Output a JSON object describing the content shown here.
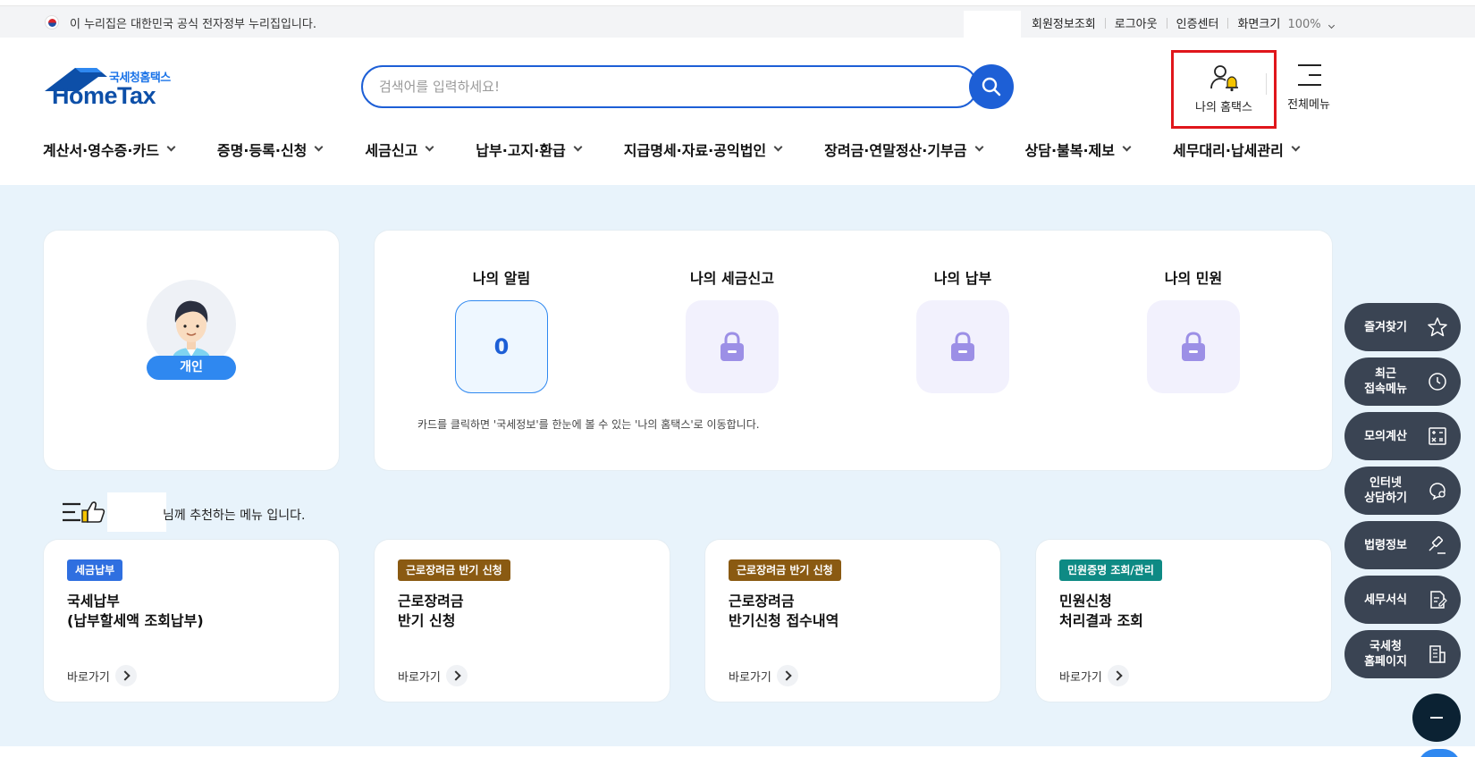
{
  "gov_banner": {
    "text": "이 누리집은 대한민국 공식 전자정부 누리집입니다."
  },
  "util": {
    "member_info": "회원정보조회",
    "logout": "로그아웃",
    "cert_center": "인증센터",
    "screen_size": "화면크기",
    "zoom": "100%"
  },
  "logo": {
    "small": "국세청홈택스",
    "big": "HomeTax"
  },
  "search": {
    "placeholder": "검색어를 입력하세요!"
  },
  "header": {
    "my_hometax": "나의 홈택스",
    "all_menu": "전체메뉴"
  },
  "gnb": [
    {
      "label": "계산서·영수증·카드"
    },
    {
      "label": "증명·등록·신청"
    },
    {
      "label": "세금신고"
    },
    {
      "label": "납부·고지·환급"
    },
    {
      "label": "지급명세·자료·공익법인"
    },
    {
      "label": "장려금·연말정산·기부금"
    },
    {
      "label": "상담·불복·제보"
    },
    {
      "label": "세무대리·납세관리"
    }
  ],
  "profile": {
    "type": "개인"
  },
  "summary": {
    "items": [
      {
        "title": "나의 알림",
        "value": "0"
      },
      {
        "title": "나의 세금신고"
      },
      {
        "title": "나의 납부"
      },
      {
        "title": "나의 민원"
      }
    ],
    "note": "카드를 클릭하면 '국세정보'를 한눈에 볼 수 있는 '나의 홈택스'로 이동합니다."
  },
  "recommend": {
    "text": "님께 추천하는 메뉴 입니다.",
    "cards": [
      {
        "tag": "세금납부",
        "tag_color": "#2f6fe0",
        "line1": "국세납부",
        "line2": "(납부할세액 조회납부)",
        "go": "바로가기"
      },
      {
        "tag": "근로장려금 반기 신청",
        "tag_color": "#8a5a12",
        "line1": "근로장려금",
        "line2": "반기 신청",
        "go": "바로가기"
      },
      {
        "tag": "근로장려금 반기 신청",
        "tag_color": "#8a5a12",
        "line1": "근로장려금",
        "line2": "반기신청 접수내역",
        "go": "바로가기"
      },
      {
        "tag": "민원증명 조회/관리",
        "tag_color": "#0e8a84",
        "line1": "민원신청",
        "line2": "처리결과 조회",
        "go": "바로가기"
      }
    ]
  },
  "quick_menu": [
    {
      "label": "즐겨찾기",
      "icon": "star-icon"
    },
    {
      "label": "최근\n접속메뉴",
      "icon": "clock-icon"
    },
    {
      "label": "모의계산",
      "icon": "calculator-icon"
    },
    {
      "label": "인터넷\n상담하기",
      "icon": "chat-icon"
    },
    {
      "label": "법령정보",
      "icon": "gavel-icon"
    },
    {
      "label": "세무서식",
      "icon": "document-icon"
    },
    {
      "label": "국세청\n홈페이지",
      "icon": "building-icon"
    }
  ],
  "colors": {
    "primary": "#1d5fd6",
    "content_bg": "#e8f3fb",
    "quick_bg": "#3a4453",
    "highlight_border": "#e0161b"
  }
}
